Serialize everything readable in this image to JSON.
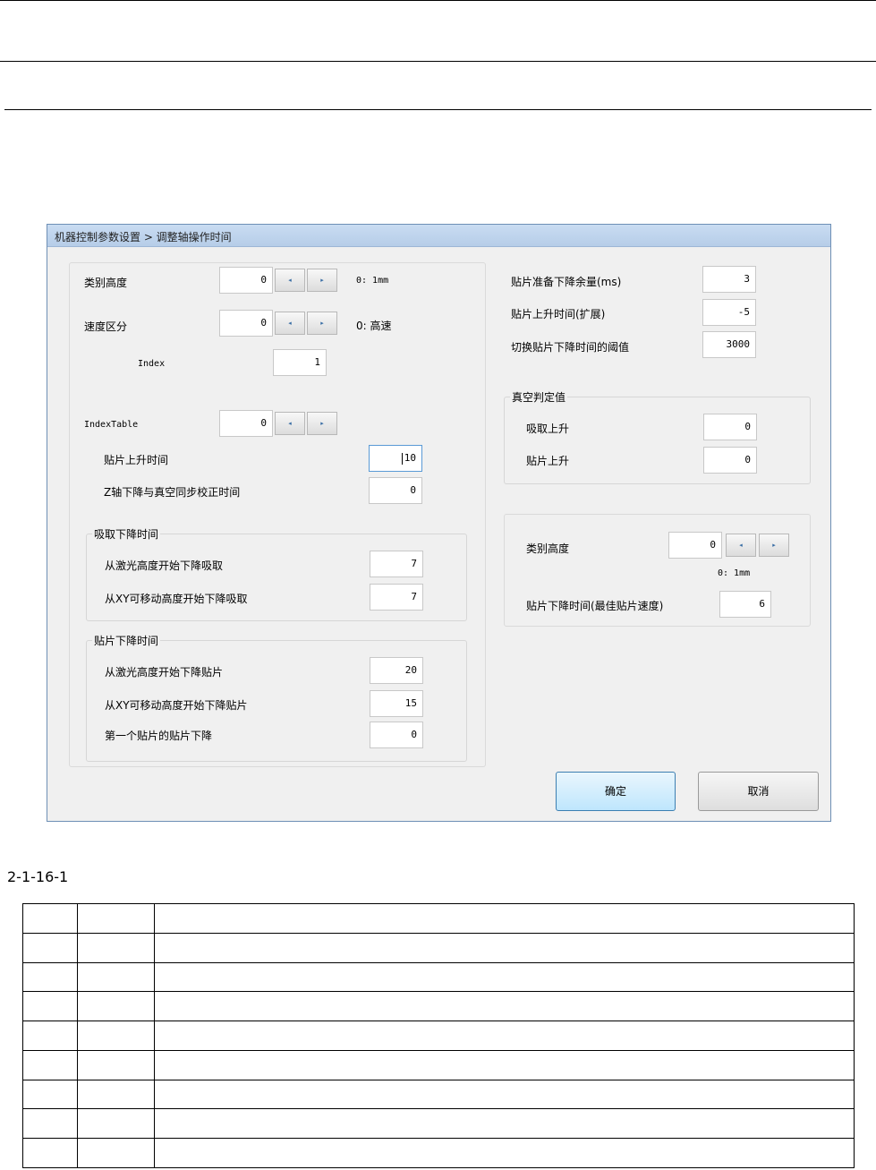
{
  "dialog": {
    "title": "机器控制参数设置 > 调整轴操作时间",
    "left": {
      "category_height": {
        "label": "类别高度",
        "value": "0",
        "note": "0: 1mm"
      },
      "speed_division": {
        "label": "速度区分",
        "value": "0",
        "note": "0: 高速"
      },
      "index": {
        "label": "Index",
        "value": "1"
      },
      "index_table": {
        "label": "IndexTable",
        "value": "0"
      },
      "mount_rise_time": {
        "label": "贴片上升时间",
        "value": "10"
      },
      "z_sync_time": {
        "label": "Z轴下降与真空同步校正时间",
        "value": "0"
      },
      "pickup_group": {
        "title": "吸取下降时间",
        "laser": {
          "label": "从激光高度开始下降吸取",
          "value": "7"
        },
        "xy": {
          "label": "从XY可移动高度开始下降吸取",
          "value": "7"
        }
      },
      "mount_group": {
        "title": "贴片下降时间",
        "laser": {
          "label": "从激光高度开始下降贴片",
          "value": "20"
        },
        "xy": {
          "label": "从XY可移动高度开始下降贴片",
          "value": "15"
        },
        "first": {
          "label": "第一个贴片的贴片下降",
          "value": "0"
        }
      }
    },
    "right": {
      "prep_margin": {
        "label": "贴片准备下降余量(ms)",
        "value": "3"
      },
      "rise_ext": {
        "label": "贴片上升时间(扩展)",
        "value": "-5"
      },
      "threshold": {
        "label": "切换贴片下降时间的阈值",
        "value": "3000"
      },
      "vacuum_group": {
        "title": "真空判定值",
        "pickup_rise": {
          "label": "吸取上升",
          "value": "0"
        },
        "mount_rise": {
          "label": "贴片上升",
          "value": "0"
        }
      },
      "category_height": {
        "label": "类别高度",
        "value": "0",
        "note": "0: 1mm"
      },
      "best_descent": {
        "label": "贴片下降时间(最佳贴片速度)",
        "value": "6"
      }
    },
    "buttons": {
      "ok": "确定",
      "cancel": "取消"
    },
    "spin_left_glyph": "◂",
    "spin_right_glyph": "▸"
  },
  "caption": "2-1-16-1"
}
